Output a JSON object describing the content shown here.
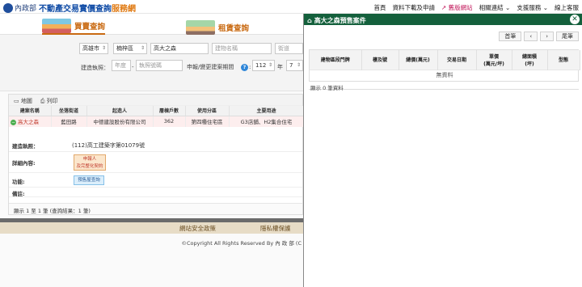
{
  "header": {
    "ministry": "內政部",
    "title": "不動產交易實價查詢",
    "title_accent": "服務網",
    "nav": [
      "首頁",
      "資料下載及申請",
      "舊版網站",
      "相關連結",
      "支援服務",
      "線上客服"
    ]
  },
  "tabs": [
    "買賣查詢",
    "租賃查詢"
  ],
  "search": {
    "city": "高雄市",
    "district": "楠梓區",
    "keyword": "高大之森",
    "building_placeholder": "建物名稱",
    "street_placeholder": "街道",
    "permit_label": "建造執照：",
    "year_placeholder": "年度",
    "permit_placeholder": "執照號碼",
    "period_label": "申報/變更建案期間",
    "year_value": "112",
    "year_unit": "年",
    "month_value": "7"
  },
  "results": {
    "map_label": "地圖",
    "print_label": "列印",
    "columns": [
      "建案名稱",
      "坐落街道",
      "起造人",
      "層棟戶數",
      "使用分區",
      "主要用途"
    ],
    "row": [
      "高大之森",
      "藍田路",
      "中德建設股份有限公司",
      "362",
      "第四種住宅區",
      "G3店舖、H2集合住宅"
    ],
    "detail": {
      "permit_key": "建造執照：",
      "permit_value": "(112)高工建築字第01079號",
      "detail_key": "詳細內容:",
      "detail_button_line1": "申報人",
      "detail_button_line2": "及完整化契約",
      "function_key": "功能:",
      "function_button": "預售屋查詢",
      "note_key": "備註:"
    },
    "footer": "顯示 1 至 1 筆 (查詢結果：1 筆)"
  },
  "footer": {
    "link1": "網站安全政策",
    "link2": "隱私權保護",
    "copyright": "©Copyright All Rights Reserved By 內 政 部 (C"
  },
  "overlay": {
    "title": "高大之森預售案件",
    "pager": [
      "首筆",
      "‹",
      "›",
      "尾筆"
    ],
    "columns": [
      "建物區段門牌",
      "樓及號",
      "總價(萬元)",
      "交易日期",
      "單價\n(萬元/坪)",
      "總面積\n(坪)",
      "型態"
    ],
    "empty": "無資料",
    "count": "顯示 0 筆資料"
  }
}
